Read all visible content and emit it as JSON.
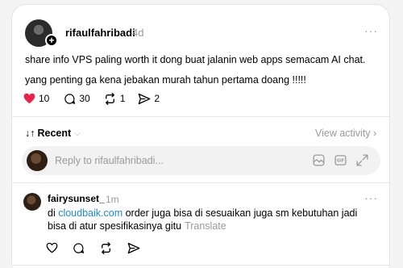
{
  "post": {
    "username": "rifaulfahribadi",
    "time": "4d",
    "more": "···",
    "text_line1": "share info VPS paling worth it dong buat jalanin web apps semacam AI chat.",
    "text_line2": "yang penting ga kena jebakan murah tahun pertama doang !!!!!",
    "likes": "10",
    "comments": "30",
    "reposts": "1",
    "shares": "2",
    "like_color": "#e8234a"
  },
  "sort": {
    "icon": "↓↑",
    "label": "Recent",
    "chevron": "⌵",
    "view_activity": "View activity ›"
  },
  "reply": {
    "placeholder": "Reply to rifaulfahribadi..."
  },
  "comment": {
    "username": "fairysunset_",
    "time": "1m",
    "more": "···",
    "text_before": "di ",
    "link": "cloudbaik.com",
    "text_after": " order juga bisa di sesuaikan juga sm kebutuhan jadi bisa di atur spesifikasinya gitu",
    "translate": "Translate",
    "link_color": "#1a8ad8"
  }
}
